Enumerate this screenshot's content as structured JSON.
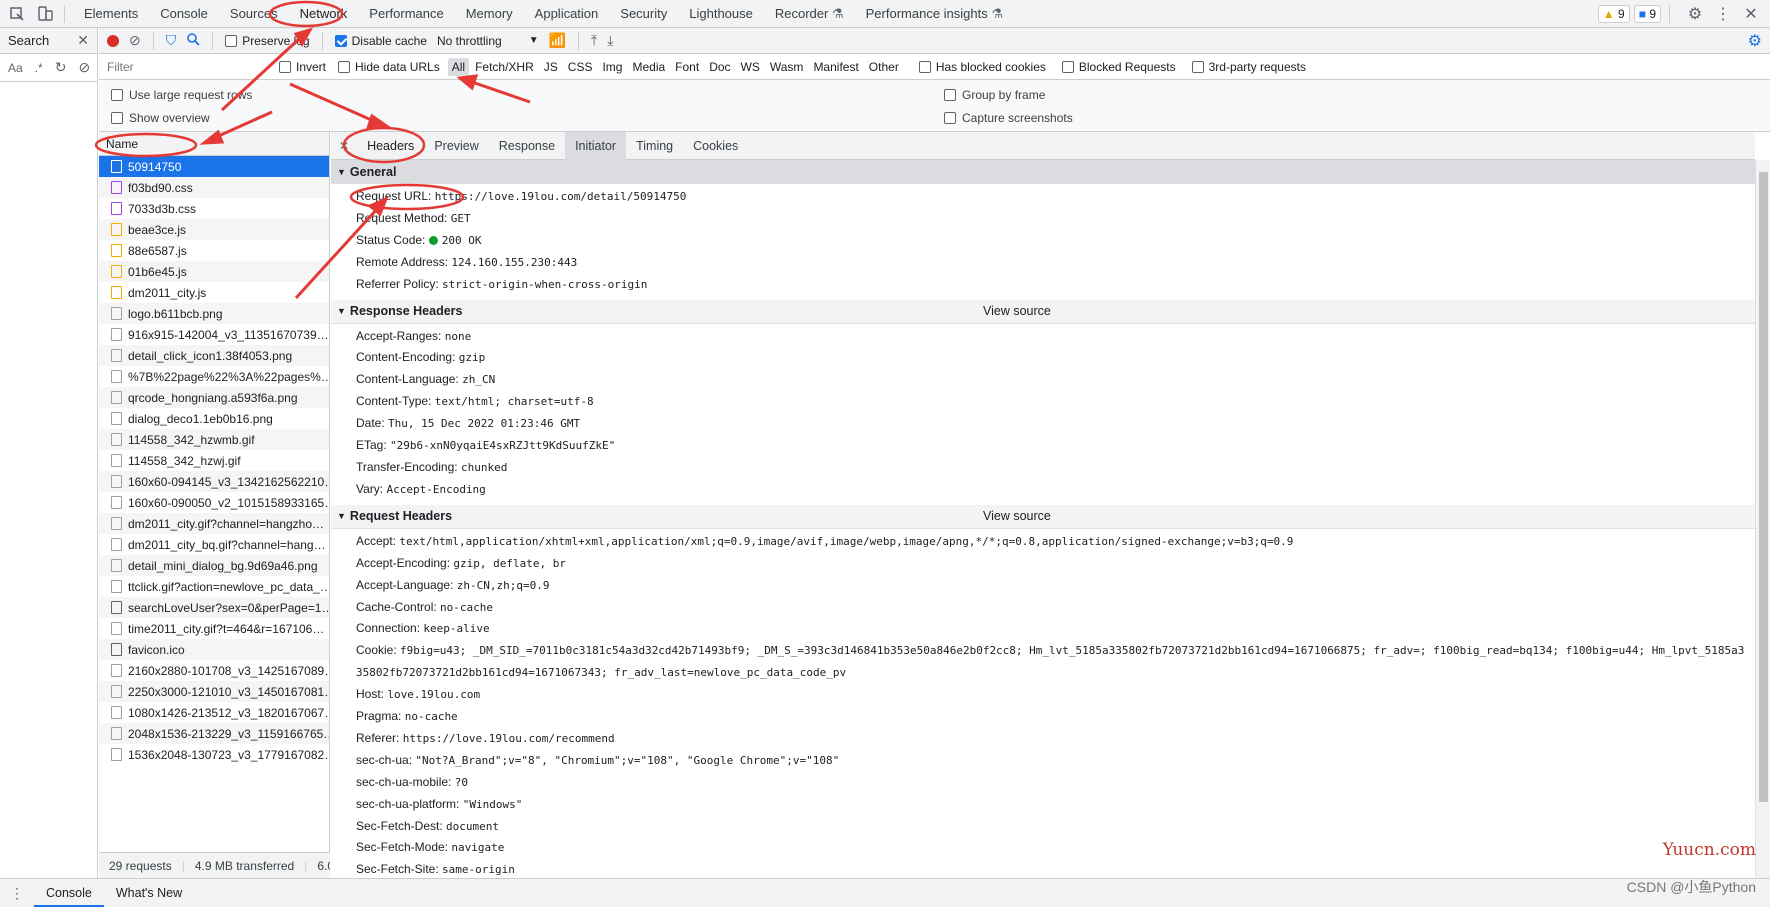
{
  "topbar": {
    "tabs": [
      "Elements",
      "Console",
      "Sources",
      "Network",
      "Performance",
      "Memory",
      "Application",
      "Security",
      "Lighthouse",
      "Recorder",
      "Performance insights"
    ],
    "active_tab": "Network",
    "warnings": "9",
    "messages": "9"
  },
  "search_panel": {
    "title": "Search",
    "aa": "Aa",
    "regex": ".*"
  },
  "toolbar": {
    "preserve_log": "Preserve log",
    "disable_cache": "Disable cache",
    "throttling": "No throttling"
  },
  "filter": {
    "placeholder": "Filter",
    "invert": "Invert",
    "hide_data_urls": "Hide data URLs",
    "types": [
      "All",
      "Fetch/XHR",
      "JS",
      "CSS",
      "Img",
      "Media",
      "Font",
      "Doc",
      "WS",
      "Wasm",
      "Manifest",
      "Other"
    ],
    "has_blocked": "Has blocked cookies",
    "blocked_requests": "Blocked Requests",
    "third_party": "3rd-party requests"
  },
  "options": {
    "large_rows": "Use large request rows",
    "overview": "Show overview",
    "group_by_frame": "Group by frame",
    "capture": "Capture screenshots"
  },
  "request_list": {
    "header": "Name",
    "items": [
      {
        "name": "50914750",
        "kind": "doc"
      },
      {
        "name": "f03bd90.css",
        "kind": "css"
      },
      {
        "name": "7033d3b.css",
        "kind": "css"
      },
      {
        "name": "beae3ce.js",
        "kind": "js"
      },
      {
        "name": "88e6587.js",
        "kind": "js"
      },
      {
        "name": "01b6e45.js",
        "kind": "js"
      },
      {
        "name": "dm2011_city.js",
        "kind": "js"
      },
      {
        "name": "logo.b611bcb.png",
        "kind": "img"
      },
      {
        "name": "916x915-142004_v3_11351670739…",
        "kind": "img"
      },
      {
        "name": "detail_click_icon1.38f4053.png",
        "kind": "img"
      },
      {
        "name": "%7B%22page%22%3A%22pages%…",
        "kind": "img"
      },
      {
        "name": "qrcode_hongniang.a593f6a.png",
        "kind": "img"
      },
      {
        "name": "dialog_deco1.1eb0b16.png",
        "kind": "img"
      },
      {
        "name": "114558_342_hzwmb.gif",
        "kind": "img"
      },
      {
        "name": "114558_342_hzwj.gif",
        "kind": "img"
      },
      {
        "name": "160x60-094145_v3_1342162562210…",
        "kind": "img"
      },
      {
        "name": "160x60-090050_v2_1015158933165…",
        "kind": "img"
      },
      {
        "name": "dm2011_city.gif?channel=hangzho…",
        "kind": "img"
      },
      {
        "name": "dm2011_city_bq.gif?channel=hang…",
        "kind": "img"
      },
      {
        "name": "detail_mini_dialog_bg.9d69a46.png",
        "kind": "img"
      },
      {
        "name": "ttclick.gif?action=newlove_pc_data_…",
        "kind": "img"
      },
      {
        "name": "searchLoveUser?sex=0&perPage=1…",
        "kind": "other"
      },
      {
        "name": "time2011_city.gif?t=464&r=167106…",
        "kind": "img"
      },
      {
        "name": "favicon.ico",
        "kind": "other"
      },
      {
        "name": "2160x2880-101708_v3_1425167089…",
        "kind": "img"
      },
      {
        "name": "2250x3000-121010_v3_1450167081…",
        "kind": "img"
      },
      {
        "name": "1080x1426-213512_v3_1820167067…",
        "kind": "img"
      },
      {
        "name": "2048x1536-213229_v3_1159166765…",
        "kind": "img"
      },
      {
        "name": "1536x2048-130723_v3_1779167082…",
        "kind": "img"
      }
    ]
  },
  "status": {
    "requests": "29 requests",
    "transferred": "4.9 MB transferred",
    "extra": "6.0"
  },
  "details": {
    "tabs": [
      "Headers",
      "Preview",
      "Response",
      "Initiator",
      "Timing",
      "Cookies"
    ],
    "general": {
      "title": "General",
      "rows": [
        {
          "k": "Request URL:",
          "v": "https://love.19lou.com/detail/50914750"
        },
        {
          "k": "Request Method:",
          "v": "GET"
        },
        {
          "k": "Status Code:",
          "v": "200 OK"
        },
        {
          "k": "Remote Address:",
          "v": "124.160.155.230:443"
        },
        {
          "k": "Referrer Policy:",
          "v": "strict-origin-when-cross-origin"
        }
      ]
    },
    "response": {
      "title": "Response Headers",
      "view_source": "View source",
      "rows": [
        {
          "k": "Accept-Ranges:",
          "v": "none"
        },
        {
          "k": "Content-Encoding:",
          "v": "gzip"
        },
        {
          "k": "Content-Language:",
          "v": "zh_CN"
        },
        {
          "k": "Content-Type:",
          "v": "text/html; charset=utf-8"
        },
        {
          "k": "Date:",
          "v": "Thu, 15 Dec 2022 01:23:46 GMT"
        },
        {
          "k": "ETag:",
          "v": "\"29b6-xnN0yqaiE4sxRZJtt9KdSuufZkE\""
        },
        {
          "k": "Transfer-Encoding:",
          "v": "chunked"
        },
        {
          "k": "Vary:",
          "v": "Accept-Encoding"
        }
      ]
    },
    "request": {
      "title": "Request Headers",
      "view_source": "View source",
      "rows": [
        {
          "k": "Accept:",
          "v": "text/html,application/xhtml+xml,application/xml;q=0.9,image/avif,image/webp,image/apng,*/*;q=0.8,application/signed-exchange;v=b3;q=0.9"
        },
        {
          "k": "Accept-Encoding:",
          "v": "gzip, deflate, br"
        },
        {
          "k": "Accept-Language:",
          "v": "zh-CN,zh;q=0.9"
        },
        {
          "k": "Cache-Control:",
          "v": "no-cache"
        },
        {
          "k": "Connection:",
          "v": "keep-alive"
        },
        {
          "k": "Cookie:",
          "v": "f9big=u43; _DM_SID_=7011b0c3181c54a3d32cd42b71493bf9; _DM_S_=393c3d146841b353e50a846e2b0f2cc8; Hm_lvt_5185a335802fb72073721d2bb161cd94=1671066875; fr_adv=; f100big_read=bq134; f100big=u44; Hm_lpvt_5185a335802fb72073721d2bb161cd94=1671067343; fr_adv_last=newlove_pc_data_code_pv",
          "wrap": true
        },
        {
          "k": "Host:",
          "v": "love.19lou.com"
        },
        {
          "k": "Pragma:",
          "v": "no-cache"
        },
        {
          "k": "Referer:",
          "v": "https://love.19lou.com/recommend"
        },
        {
          "k": "sec-ch-ua:",
          "v": "\"Not?A_Brand\";v=\"8\", \"Chromium\";v=\"108\", \"Google Chrome\";v=\"108\""
        },
        {
          "k": "sec-ch-ua-mobile:",
          "v": "?0"
        },
        {
          "k": "sec-ch-ua-platform:",
          "v": "\"Windows\""
        },
        {
          "k": "Sec-Fetch-Dest:",
          "v": "document"
        },
        {
          "k": "Sec-Fetch-Mode:",
          "v": "navigate"
        },
        {
          "k": "Sec-Fetch-Site:",
          "v": "same-origin"
        }
      ]
    }
  },
  "drawer": {
    "tabs": [
      "Console",
      "What's New"
    ]
  },
  "watermark": "Yuucn.com",
  "csdn": "CSDN @小鱼Python",
  "colors": {
    "accent": "#1a73e8",
    "annotation": "#e53935",
    "record": "#d93025"
  }
}
